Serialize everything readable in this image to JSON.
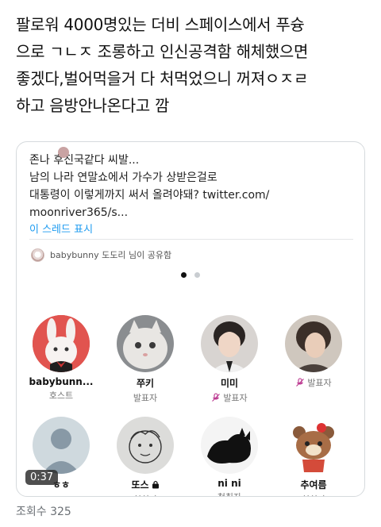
{
  "tweet": {
    "lines": [
      "팔로워 4000명있는 더비 스페이스에서 푸슝",
      "으로 ㄱㄴㅈ 조롱하고 인신공격함 해체했으면",
      "좋겠다,벌어먹을거 다 처먹었으니 꺼져ㅇㅈㄹ",
      "하고 음방안나온다고 깜"
    ]
  },
  "quote": {
    "lines": [
      "존나 후진국같다 씨발...",
      "남의 나라 연말쇼에서 가수가 상받은걸로",
      "대통령이 이렇게까지 써서 올려야돼? twitter.com/",
      "moonriver365/s..."
    ],
    "show_thread": "이 스레드 표시"
  },
  "space": {
    "shared_by": "babybunny 도도리 님이 공유함",
    "participants": [
      {
        "name": "babybunn...",
        "role": "호스트",
        "muted": false,
        "icon": "bunny-avatar"
      },
      {
        "name": "쭈키",
        "role": "발표자",
        "muted": false,
        "icon": "cat-avatar"
      },
      {
        "name": "미미",
        "role": "발표자",
        "muted": true,
        "icon": "person-avatar"
      },
      {
        "name": "",
        "role": "발표자",
        "muted": true,
        "icon": "person-avatar"
      },
      {
        "name": "ㅎㅎ",
        "role": "",
        "muted": false,
        "icon": "default-avatar"
      },
      {
        "name": "또스",
        "role": "청취자",
        "muted": false,
        "locked": true,
        "icon": "sketch-avatar"
      },
      {
        "name": "ni ni",
        "role": "청취자",
        "muted": false,
        "icon": "cat-avatar"
      },
      {
        "name": "추여름",
        "role": "청취자",
        "muted": false,
        "icon": "bear-avatar"
      }
    ]
  },
  "video": {
    "time": "0:37"
  },
  "views": "조회수 325",
  "colors": {
    "accent": "#1d9bf0",
    "mute": "#b9318c"
  }
}
